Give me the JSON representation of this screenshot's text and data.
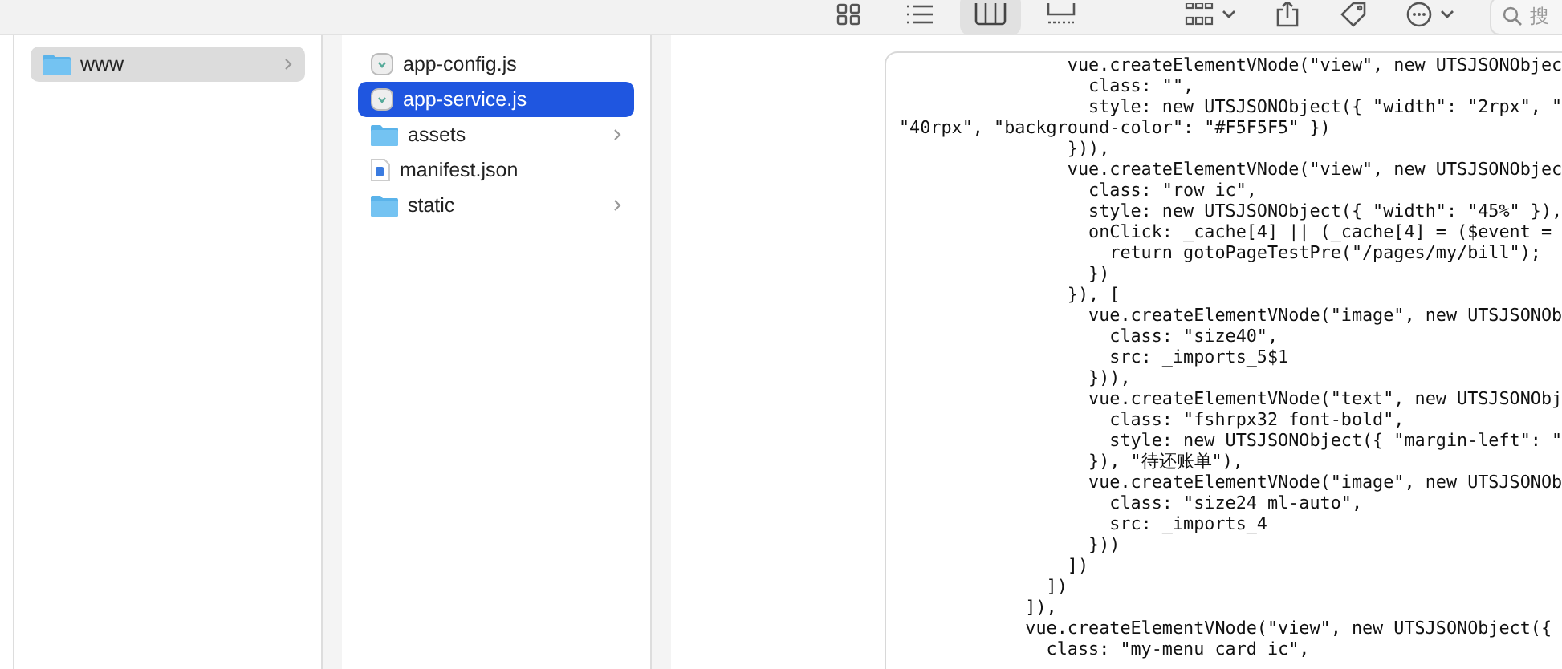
{
  "toolbar": {
    "view_buttons": [
      {
        "kind": "icons",
        "selected": false
      },
      {
        "kind": "list",
        "selected": false
      },
      {
        "kind": "columns",
        "selected": true
      },
      {
        "kind": "gallery",
        "selected": false
      }
    ],
    "actions": [
      {
        "kind": "group",
        "menu": true
      },
      {
        "kind": "share",
        "menu": false
      },
      {
        "kind": "tag",
        "menu": false
      },
      {
        "kind": "more",
        "menu": true
      }
    ],
    "search": {
      "placeholder": "搜"
    }
  },
  "columns": [
    {
      "focused": false,
      "items": [
        {
          "name": "www",
          "kind": "folder",
          "selected": true
        }
      ]
    },
    {
      "focused": true,
      "items": [
        {
          "name": "app-config.js",
          "kind": "script",
          "selected": false
        },
        {
          "name": "app-service.js",
          "kind": "script",
          "selected": true
        },
        {
          "name": "assets",
          "kind": "folder",
          "selected": false
        },
        {
          "name": "manifest.json",
          "kind": "json",
          "selected": false
        },
        {
          "name": "static",
          "kind": "folder",
          "selected": false
        }
      ]
    }
  ],
  "preview": {
    "code_lines": [
      "                vue.createElementVNode(\"view\", new UTSJSONObjec",
      "                  class: \"\",",
      "                  style: new UTSJSONObject({ \"width\": \"2rpx\", \"",
      "\"40rpx\", \"background-color\": \"#F5F5F5\" })",
      "                })),",
      "                vue.createElementVNode(\"view\", new UTSJSONObjec",
      "                  class: \"row ic\",",
      "                  style: new UTSJSONObject({ \"width\": \"45%\" }),",
      "                  onClick: _cache[4] || (_cache[4] = ($event =",
      "                    return gotoPageTestPre(\"/pages/my/bill\");",
      "                  })",
      "                }), [",
      "                  vue.createElementVNode(\"image\", new UTSJSONOb",
      "                    class: \"size40\",",
      "                    src: _imports_5$1",
      "                  })),",
      "                  vue.createElementVNode(\"text\", new UTSJSONObj",
      "                    class: \"fshrpx32 font-bold\",",
      "                    style: new UTSJSONObject({ \"margin-left\": \"",
      "                  }), \"待还账单\"),",
      "                  vue.createElementVNode(\"image\", new UTSJSONOb",
      "                    class: \"size24 ml-auto\",",
      "                    src: _imports_4",
      "                  }))",
      "                ])",
      "              ])",
      "            ]),",
      "            vue.createElementVNode(\"view\", new UTSJSONObject({",
      "              class: \"my-menu card ic\","
    ]
  }
}
